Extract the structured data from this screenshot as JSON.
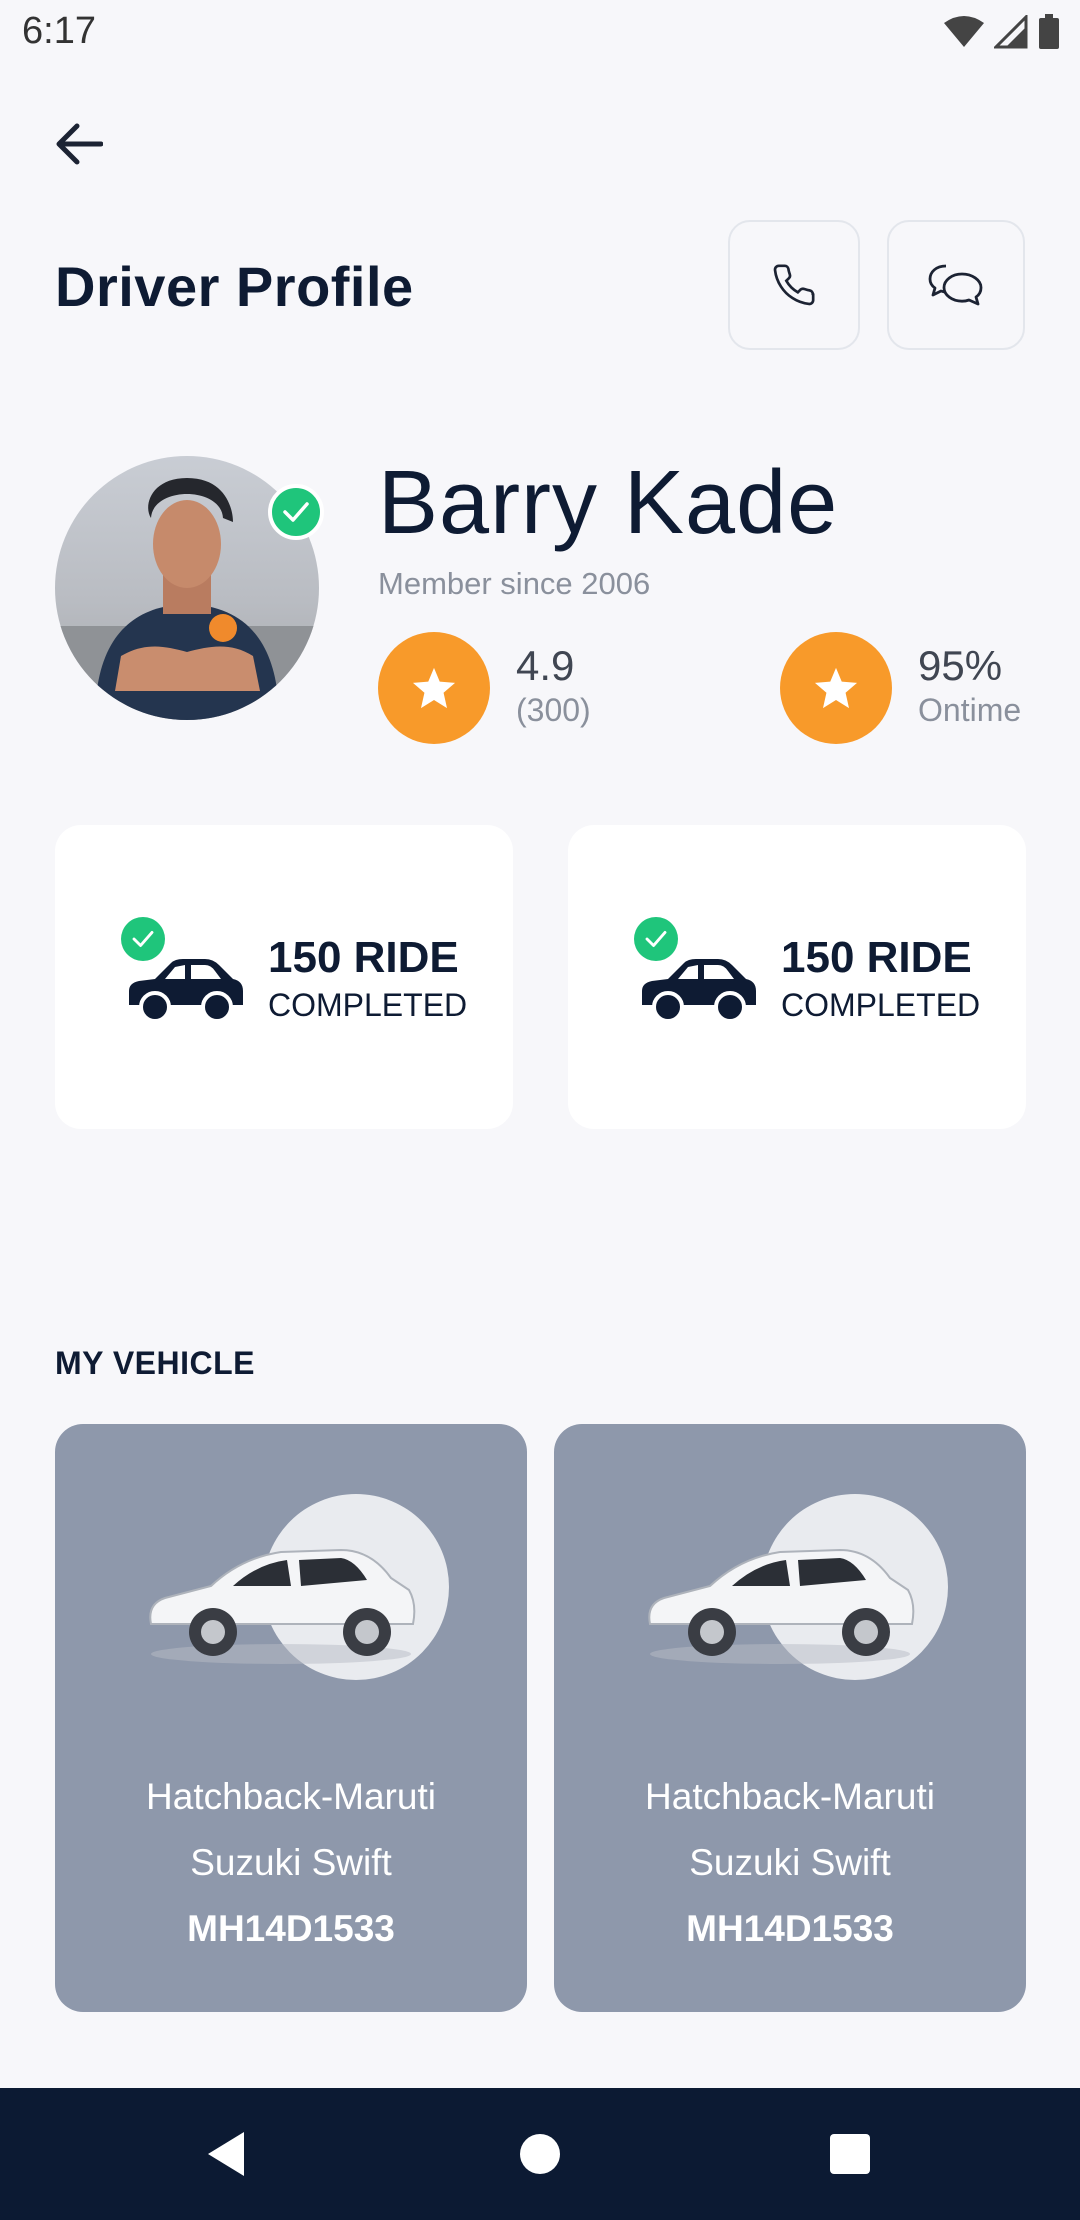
{
  "status_bar": {
    "time": "6:17"
  },
  "header": {
    "title": "Driver Profile"
  },
  "profile": {
    "name": "Barry Kade",
    "member_since": "Member since 2006",
    "rating": {
      "value": "4.9",
      "count": "(300)"
    },
    "ontime": {
      "value": "95%",
      "label": "Ontime"
    }
  },
  "ride_cards": [
    {
      "count": "150 RIDE",
      "label": "COMPLETED"
    },
    {
      "count": "150 RIDE",
      "label": "COMPLETED"
    }
  ],
  "vehicles_section": {
    "title": "MY VEHICLE"
  },
  "vehicles": [
    {
      "type": "Hatchback-Maruti",
      "model": "Suzuki Swift",
      "plate": "MH14D1533"
    },
    {
      "type": "Hatchback-Maruti",
      "model": "Suzuki Swift",
      "plate": "MH14D1533"
    }
  ],
  "colors": {
    "accent_orange": "#f89a2a",
    "verified_green": "#1fc57b",
    "navy": "#0e1b33",
    "vehicle_card": "#8e98ab"
  },
  "icons": [
    "back-arrow-icon",
    "phone-icon",
    "chat-icon",
    "star-icon",
    "check-icon",
    "car-icon",
    "wifi-icon",
    "signal-icon",
    "battery-icon"
  ]
}
